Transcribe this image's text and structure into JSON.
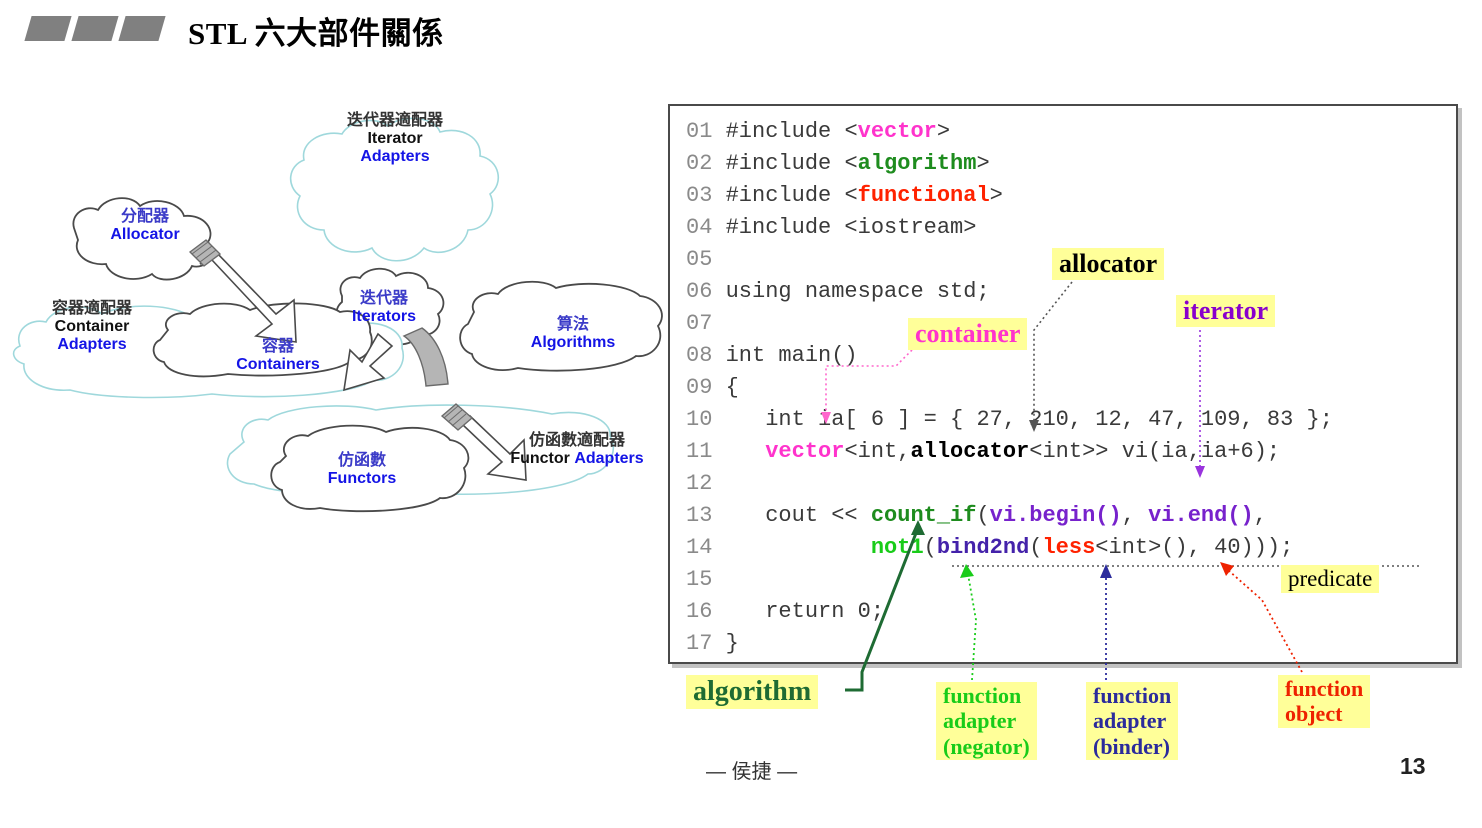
{
  "slide": {
    "title": "STL 六大部件關係",
    "footer_author": "— 侯捷 —",
    "page_number": "13",
    "accent_colors": {
      "title_mark": "#808080",
      "highlight": "#ffff99",
      "diagram_blue": "#1414e6",
      "cloud_outline": "#9fd8dc"
    }
  },
  "diagram": {
    "nodes": [
      {
        "id": "allocator",
        "cn": "分配器",
        "en": "Allocator"
      },
      {
        "id": "iterator-adapters",
        "cn": "迭代器適配器",
        "en_line1": "Iterator",
        "en_line2": "Adapters"
      },
      {
        "id": "iterators",
        "cn": "迭代器",
        "en": "Iterators"
      },
      {
        "id": "container-adapters",
        "cn": "容器適配器",
        "en_line1": "Container",
        "en_line2": "Adapters"
      },
      {
        "id": "containers",
        "cn": "容器",
        "en": "Containers"
      },
      {
        "id": "algorithms",
        "cn": "算法",
        "en": "Algorithms"
      },
      {
        "id": "functors",
        "cn": "仿函數",
        "en": "Functors"
      },
      {
        "id": "functor-adapters",
        "cn": "仿函數適配器",
        "en_line1": "Functor",
        "en_line2": "Adapters"
      }
    ]
  },
  "code": {
    "lines": [
      {
        "no": "01",
        "tokens": [
          {
            "t": "#include ",
            "c": "c-plain"
          },
          {
            "t": "<",
            "c": "c-plain"
          },
          {
            "t": "vector",
            "c": "c-magenta"
          },
          {
            "t": ">",
            "c": "c-plain"
          }
        ]
      },
      {
        "no": "02",
        "tokens": [
          {
            "t": "#include ",
            "c": "c-plain"
          },
          {
            "t": "<",
            "c": "c-plain"
          },
          {
            "t": "algorithm",
            "c": "c-green"
          },
          {
            "t": ">",
            "c": "c-plain"
          }
        ]
      },
      {
        "no": "03",
        "tokens": [
          {
            "t": "#include ",
            "c": "c-plain"
          },
          {
            "t": "<",
            "c": "c-plain"
          },
          {
            "t": "functional",
            "c": "c-red"
          },
          {
            "t": ">",
            "c": "c-plain"
          }
        ]
      },
      {
        "no": "04",
        "tokens": [
          {
            "t": "#include <iostream>",
            "c": "c-plain"
          }
        ]
      },
      {
        "no": "05",
        "tokens": []
      },
      {
        "no": "06",
        "tokens": [
          {
            "t": "using namespace std;",
            "c": "c-plain"
          }
        ]
      },
      {
        "no": "07",
        "tokens": []
      },
      {
        "no": "08",
        "tokens": [
          {
            "t": "int main()",
            "c": "c-plain"
          }
        ]
      },
      {
        "no": "09",
        "tokens": [
          {
            "t": "{",
            "c": "c-plain"
          }
        ]
      },
      {
        "no": "10",
        "tokens": [
          {
            "t": "   int ia[ 6 ] = { 27, 210, 12, 47, 109, 83 };",
            "c": "c-plain"
          }
        ]
      },
      {
        "no": "11",
        "tokens": [
          {
            "t": "   ",
            "c": "c-plain"
          },
          {
            "t": "vector",
            "c": "c-magenta"
          },
          {
            "t": "<int,",
            "c": "c-plain"
          },
          {
            "t": "allocator",
            "c": "c-black-b"
          },
          {
            "t": "<int>> vi(ia,ia+6);",
            "c": "c-plain"
          }
        ]
      },
      {
        "no": "12",
        "tokens": []
      },
      {
        "no": "13",
        "tokens": [
          {
            "t": "   cout << ",
            "c": "c-plain"
          },
          {
            "t": "count_if",
            "c": "c-green"
          },
          {
            "t": "(",
            "c": "c-plain"
          },
          {
            "t": "vi.begin()",
            "c": "c-purple"
          },
          {
            "t": ", ",
            "c": "c-plain"
          },
          {
            "t": "vi.end()",
            "c": "c-purple"
          },
          {
            "t": ",",
            "c": "c-plain"
          }
        ]
      },
      {
        "no": "14",
        "tokens": [
          {
            "t": "           ",
            "c": "c-plain"
          },
          {
            "t": "not1",
            "c": "c-brightgreen"
          },
          {
            "t": "(",
            "c": "c-plain"
          },
          {
            "t": "bind2nd",
            "c": "c-indigo"
          },
          {
            "t": "(",
            "c": "c-plain"
          },
          {
            "t": "less",
            "c": "c-red"
          },
          {
            "t": "<int>(), 40)));",
            "c": "c-plain"
          }
        ]
      },
      {
        "no": "15",
        "tokens": []
      },
      {
        "no": "16",
        "tokens": [
          {
            "t": "   return 0;",
            "c": "c-plain"
          }
        ]
      },
      {
        "no": "17",
        "tokens": [
          {
            "t": "}",
            "c": "c-plain"
          }
        ]
      }
    ]
  },
  "annotations": {
    "allocator": "allocator",
    "iterator": "iterator",
    "container": "container",
    "predicate": "predicate",
    "algorithm": "algorithm",
    "function_adapter_negator": "function\nadapter\n(negator)",
    "function_adapter_binder": "function\nadapter\n(binder)",
    "function_object": "function\nobject"
  }
}
